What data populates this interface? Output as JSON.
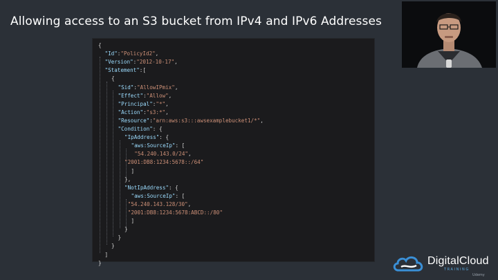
{
  "slide": {
    "title": "Allowing access to an S3 bucket from IPv4 and IPv6 Addresses"
  },
  "code_lines": [
    {
      "indent": 0,
      "key": "",
      "sep": "{",
      "val": "",
      "tail": ""
    },
    {
      "indent": 1,
      "key": "\"Id\"",
      "sep": ":",
      "val": "\"PolicyId2\"",
      "tail": ","
    },
    {
      "indent": 1,
      "key": "\"Version\"",
      "sep": ":",
      "val": "\"2012-10-17\"",
      "tail": ","
    },
    {
      "indent": 1,
      "key": "\"Statement\"",
      "sep": ":[",
      "val": "",
      "tail": ""
    },
    {
      "indent": 2,
      "key": "",
      "sep": "{",
      "val": "",
      "tail": ""
    },
    {
      "indent": 3,
      "key": "\"Sid\"",
      "sep": ":",
      "val": "\"AllowIPmix\"",
      "tail": ","
    },
    {
      "indent": 3,
      "key": "\"Effect\"",
      "sep": ":",
      "val": "\"Allow\"",
      "tail": ","
    },
    {
      "indent": 3,
      "key": "\"Principal\"",
      "sep": ":",
      "val": "\"*\"",
      "tail": ","
    },
    {
      "indent": 3,
      "key": "\"Action\"",
      "sep": ":",
      "val": "\"s3:*\"",
      "tail": ","
    },
    {
      "indent": 3,
      "key": "\"Resource\"",
      "sep": ":",
      "val": "\"arn:aws:s3:::awsexamplebucket1/*\"",
      "tail": ","
    },
    {
      "indent": 3,
      "key": "\"Condition\"",
      "sep": ": {",
      "val": "",
      "tail": ""
    },
    {
      "indent": 4,
      "key": "\"IpAddress\"",
      "sep": ": {",
      "val": "",
      "tail": ""
    },
    {
      "indent": 5,
      "key": "\"aws:SourceIp\"",
      "sep": ": [",
      "val": "",
      "tail": ""
    },
    {
      "indent": 5.5,
      "key": "",
      "sep": "",
      "val": "\"54.240.143.0/24\"",
      "tail": ","
    },
    {
      "indent": 4,
      "key": "",
      "sep": "",
      "val": "\"2001:DB8:1234:5678::/64\"",
      "tail": ""
    },
    {
      "indent": 5,
      "key": "",
      "sep": "]",
      "val": "",
      "tail": ""
    },
    {
      "indent": 4,
      "key": "",
      "sep": "},",
      "val": "",
      "tail": ""
    },
    {
      "indent": 4,
      "key": "\"NotIpAddress\"",
      "sep": ": {",
      "val": "",
      "tail": ""
    },
    {
      "indent": 5,
      "key": "\"aws:SourceIp\"",
      "sep": ": [",
      "val": "",
      "tail": ""
    },
    {
      "indent": 4.5,
      "key": "",
      "sep": "",
      "val": "\"54.240.143.128/30\"",
      "tail": ","
    },
    {
      "indent": 4.5,
      "key": "",
      "sep": "",
      "val": "\"2001:DB8:1234:5678:ABCD::/80\"",
      "tail": ""
    },
    {
      "indent": 5,
      "key": "",
      "sep": "]",
      "val": "",
      "tail": ""
    },
    {
      "indent": 4,
      "key": "",
      "sep": "}",
      "val": "",
      "tail": ""
    },
    {
      "indent": 3,
      "key": "",
      "sep": "}",
      "val": "",
      "tail": ""
    },
    {
      "indent": 2,
      "key": "",
      "sep": "}",
      "val": "",
      "tail": ""
    },
    {
      "indent": 1,
      "key": "",
      "sep": "]",
      "val": "",
      "tail": ""
    },
    {
      "indent": 0,
      "key": "",
      "sep": "}",
      "val": "",
      "tail": ""
    }
  ],
  "logo": {
    "name": "DigitalCloud",
    "tagline": "TRAINING"
  },
  "watermark": {
    "text": "Udemy"
  },
  "colors": {
    "background": "#2b3037",
    "code_key": "#9cdcfe",
    "code_string": "#ce9178",
    "code_punct": "#d4d4d4",
    "logo_blue": "#3a8fd6"
  }
}
